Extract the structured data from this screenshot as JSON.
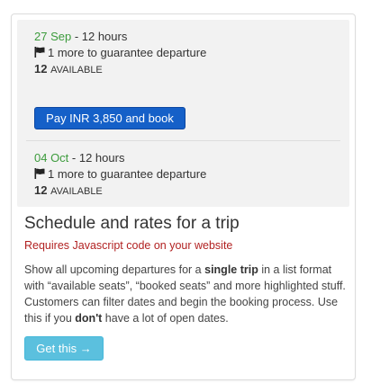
{
  "departures": [
    {
      "date": "27 Sep",
      "duration": " - 12 hours",
      "guarantee_text": "1 more to guarantee departure",
      "available_count": "12",
      "available_label": "AVAILABLE"
    },
    {
      "date": "04 Oct",
      "duration": " - 12 hours",
      "guarantee_text": "1 more to guarantee departure",
      "available_count": "12",
      "available_label": "AVAILABLE"
    }
  ],
  "pay_button_label": "Pay INR 3,850 and book",
  "title": "Schedule and rates for a trip",
  "requirement": "Requires Javascript code on your website",
  "description": {
    "p1": "Show all upcoming departures for a ",
    "b1": "single trip",
    "p2": " in a list format with “available seats”, “booked seats” and more highlighted stuff. Customers can filter dates and begin the booking process. Use this if you ",
    "b2": "don't",
    "p3": " have a lot of open dates."
  },
  "get_button_label": "Get this →",
  "colors": {
    "date_green": "#3c9b3c",
    "pay_button": "#1560c8",
    "requirement_red": "#b22222",
    "get_button": "#5bc0de"
  },
  "icons": {
    "guarantee": "flag-icon"
  }
}
